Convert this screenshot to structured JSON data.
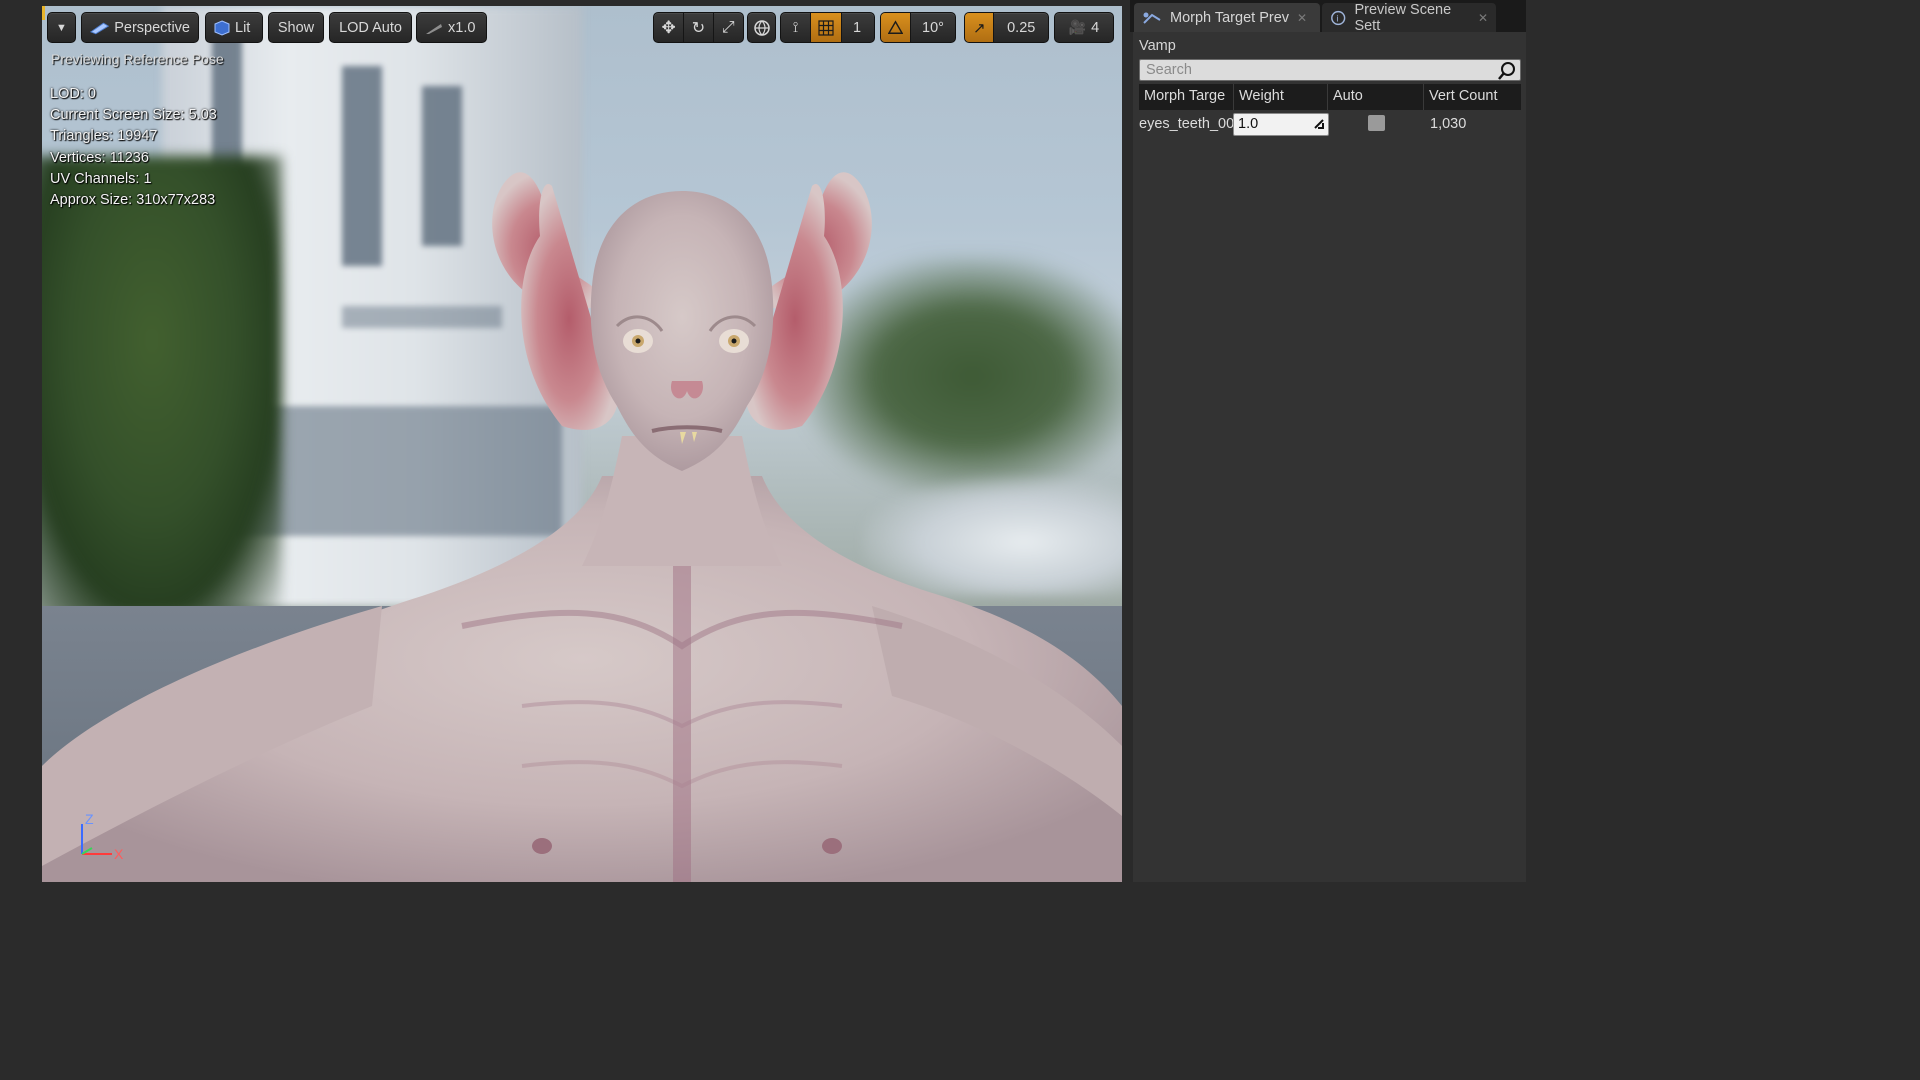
{
  "viewport": {
    "toolbar": {
      "perspective_label": "Perspective",
      "lit_label": "Lit",
      "show_label": "Show",
      "lod_label": "LOD Auto",
      "speed_label": "x1.0",
      "grid_snap_value": "1",
      "rotate_snap_value": "10°",
      "scale_snap_value": "0.25",
      "camera_speed_value": "4"
    },
    "preview_label": "Previewing Reference Pose",
    "stats": [
      "LOD: 0",
      "Current Screen Size: 5.03",
      "Triangles: 19947",
      "Vertices: 11236",
      "UV Channels: 1",
      "Approx Size: 310x77x283"
    ],
    "axis": {
      "z_label": "Z",
      "x_label": "X"
    }
  },
  "panel": {
    "tabs": [
      {
        "label": "Morph Target Prev",
        "icon": "morph-target-icon",
        "active": true
      },
      {
        "label": "Preview Scene Sett",
        "icon": "preview-scene-icon",
        "active": false
      }
    ],
    "mesh_name": "Vamp",
    "search_placeholder": "Search",
    "columns": [
      "Morph Targe",
      "Weight",
      "Auto",
      "Vert Count"
    ],
    "rows": [
      {
        "name": "eyes_teeth_00",
        "weight": "1.0",
        "auto": false,
        "vert_count": "1,030"
      }
    ]
  },
  "colors": {
    "accent_orange": "#d9901e",
    "panel_bg": "#333333"
  }
}
